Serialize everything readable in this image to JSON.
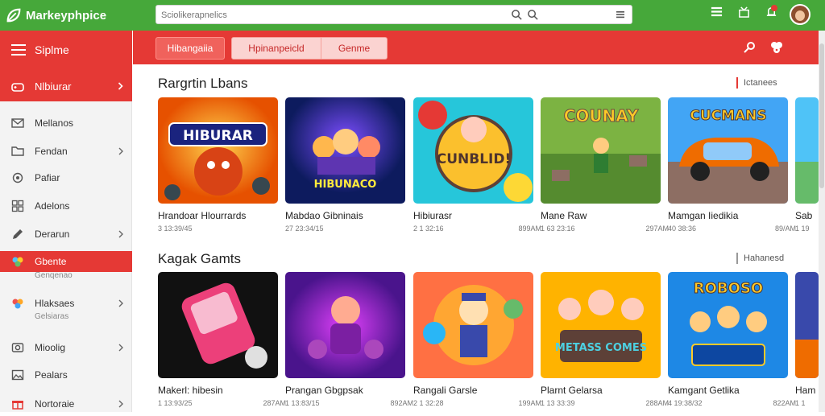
{
  "app": {
    "title": "Markeyphpice"
  },
  "search": {
    "placeholder": "Sciolikerapnelics"
  },
  "sidebar": {
    "header_label": "Siplme",
    "selected": {
      "label": "Nlbiurar",
      "icon": "game-controller-icon"
    },
    "items": [
      {
        "label": "Mellanos",
        "icon": "mail-icon",
        "chevron": false
      },
      {
        "label": "Fendan",
        "icon": "folder-icon",
        "chevron": true
      },
      {
        "label": "Pafiar",
        "icon": "gear-icon",
        "chevron": false
      },
      {
        "label": "Adelons",
        "icon": "grid-icon",
        "chevron": false
      },
      {
        "label": "Derarun",
        "icon": "pencil-icon",
        "chevron": true
      },
      {
        "label": "Gbente",
        "sub": "Genqenao",
        "icon": "game-icon",
        "chevron": false,
        "active": true
      },
      {
        "label": "Hlaksaes",
        "sub": "Gelsiaras",
        "icon": "puzzle-icon",
        "chevron": true
      },
      {
        "label": "Mioolig",
        "icon": "camera-icon",
        "chevron": true
      },
      {
        "label": "Pealars",
        "icon": "image-icon",
        "chevron": false
      },
      {
        "label": "Nortoraie",
        "icon": "gift-icon",
        "chevron": true
      }
    ]
  },
  "tabs": [
    {
      "label": "Hibangaiia"
    },
    {
      "label": "Hpinanpeicld"
    },
    {
      "label": "Genme"
    }
  ],
  "sections": [
    {
      "title": "Rargrtin Lbans",
      "link": "Ictanees",
      "cards": [
        {
          "name": "Hrandoar Hlourrards",
          "meta": "3 13:39/45",
          "size": "",
          "art": "HIBURAR",
          "theme": "orange"
        },
        {
          "name": "Mabdao Gibninais",
          "meta": "27 23:34/15",
          "size": "",
          "art": "HIBUNACO",
          "theme": "blue"
        },
        {
          "name": "Hibiurasr",
          "meta": "2 1 32:16",
          "size": "899AM",
          "art": "CUNBLID!",
          "theme": "teal"
        },
        {
          "name": "Mane Raw",
          "meta": "1 63 23:16",
          "size": "297AM",
          "art": "COUNAY",
          "theme": "green"
        },
        {
          "name": "Mamgan Iiedikia",
          "meta": "40 38:36",
          "size": "89/AM",
          "art": "CUCMANS",
          "theme": "car"
        },
        {
          "name": "Sab",
          "meta": "1 19",
          "size": "",
          "art": "",
          "theme": "partial"
        }
      ]
    },
    {
      "title": "Kagak Gamts",
      "link": "Hahanesd",
      "cards": [
        {
          "name": "Makerl: hibesin",
          "meta": "1 13:93/25",
          "size": "287AM",
          "art": "",
          "theme": "pink"
        },
        {
          "name": "Prangan Gbgpsak",
          "meta": "1 13:83/15",
          "size": "892AM",
          "art": "",
          "theme": "purple"
        },
        {
          "name": "Rangali Garsle",
          "meta": "2 1 32:28",
          "size": "199AM",
          "art": "",
          "theme": "magic"
        },
        {
          "name": "Plarnt Gelarsa",
          "meta": "1 13 33:39",
          "size": "288AM",
          "art": "METASS COMES",
          "theme": "sunset"
        },
        {
          "name": "Kamgant Getlika",
          "meta": "4 19:38/32",
          "size": "822AM",
          "art": "ROBOSO",
          "theme": "arena"
        },
        {
          "name": "Ham",
          "meta": "1 1",
          "size": "",
          "art": "",
          "theme": "partial2"
        }
      ]
    }
  ],
  "colors": {
    "topbar": "#46a83a",
    "accent": "#e53935",
    "sidebar_bg": "#f3f3f3"
  }
}
